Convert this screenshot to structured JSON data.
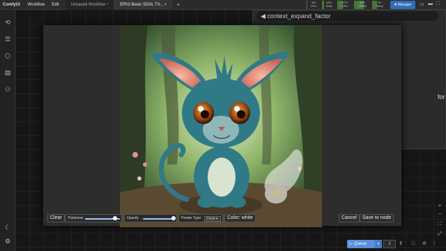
{
  "topbar": {
    "brand": "ComfyUI",
    "menu": [
      "Workflow",
      "Edit"
    ],
    "tabs": [
      {
        "label": "Unsaved Workflow"
      },
      {
        "label": "EP03 Basic SDXL TX..."
      }
    ],
    "stats": [
      {
        "label": "CPU",
        "value": "4%",
        "level": 0.04
      },
      {
        "label": "RAM",
        "value": "14%",
        "level": 0.14
      },
      {
        "label": "GPU",
        "value": "37%",
        "level": 0.37
      },
      {
        "label": "VRAM",
        "value": "57%",
        "level": 0.57
      },
      {
        "label": "Temp",
        "value": "34°",
        "level": 0.34
      }
    ],
    "manager_label": "Manager"
  },
  "sidebar": {
    "items": [
      {
        "icon": "history-icon"
      },
      {
        "icon": "queue-icon"
      },
      {
        "icon": "node-library-icon"
      },
      {
        "icon": "model-library-icon"
      },
      {
        "icon": "workflows-icon"
      }
    ],
    "bottom_icons": [
      "theme-toggle-icon",
      "settings-icon"
    ]
  },
  "graph": {
    "widget_label": "◀ context_expand_factor",
    "right_label": "for"
  },
  "mask_editor": {
    "clear_label": "Clear",
    "thickness_label": "Thickness",
    "thickness_value": 0.85,
    "opacity_label": "Opacity",
    "opacity_value": 0.95,
    "pointer_type_label": "Pointer Type:",
    "pointer_type_value": "Circle ▾",
    "color_label": "Color: white",
    "cancel_label": "Cancel",
    "save_label": "Save to node"
  },
  "queue": {
    "queue_label": "Queue",
    "batch_count": "1"
  },
  "colors": {
    "accent": "#5b8fdc",
    "manager": "#2f6db8",
    "brush_track": "#aac6ff"
  }
}
